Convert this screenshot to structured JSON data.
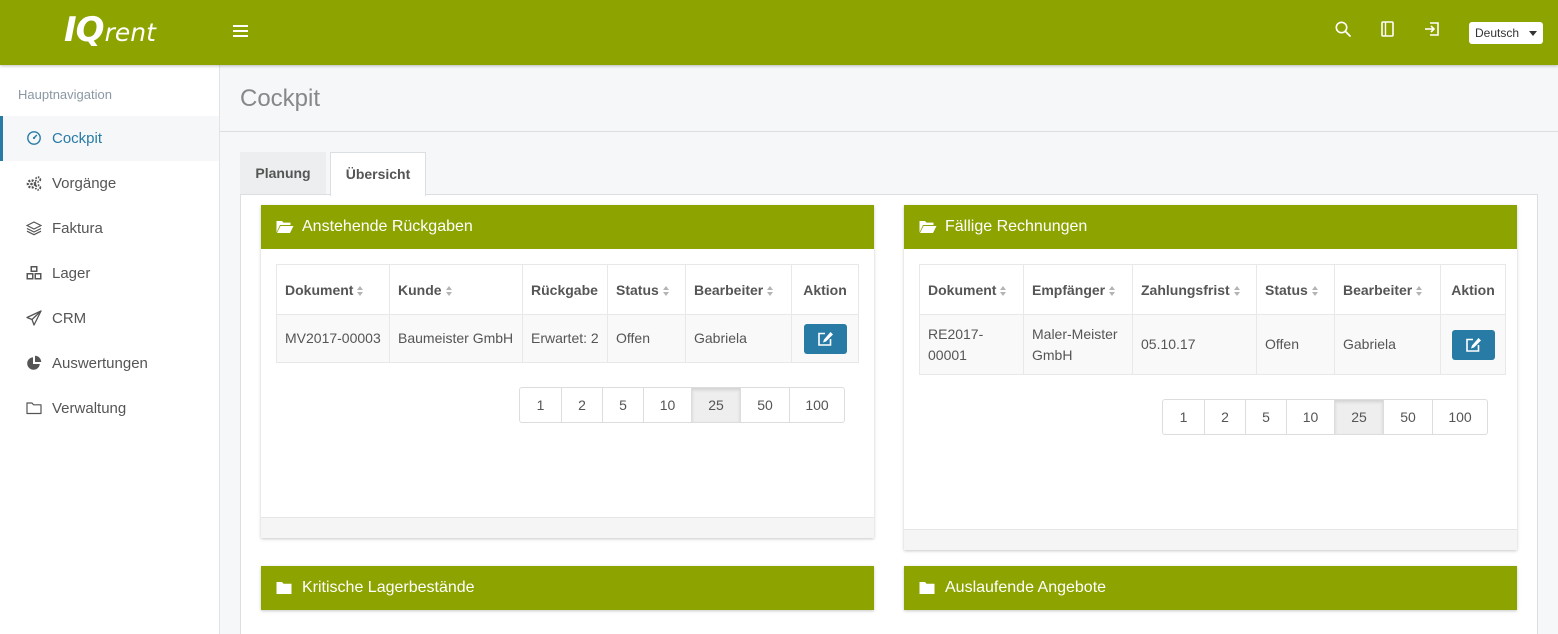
{
  "header": {
    "logo_iq": "IQ",
    "logo_rent": "rent",
    "language": "Deutsch"
  },
  "sidebar": {
    "heading": "Hauptnavigation",
    "items": [
      {
        "label": "Cockpit",
        "icon": "dashboard-icon",
        "active": true
      },
      {
        "label": "Vorgänge",
        "icon": "cogs-icon"
      },
      {
        "label": "Faktura",
        "icon": "layers-icon"
      },
      {
        "label": "Lager",
        "icon": "cubes-icon"
      },
      {
        "label": "CRM",
        "icon": "paper-plane-icon"
      },
      {
        "label": "Auswertungen",
        "icon": "pie-chart-icon"
      },
      {
        "label": "Verwaltung",
        "icon": "folder-icon"
      }
    ]
  },
  "page": {
    "title": "Cockpit",
    "tabs": [
      {
        "label": "Planung"
      },
      {
        "label": "Übersicht",
        "active": true
      }
    ]
  },
  "returns_panel": {
    "title": "Anstehende Rückgaben",
    "columns": [
      "Dokument",
      "Kunde",
      "Rückgabe",
      "Status",
      "Bearbeiter",
      "Aktion"
    ],
    "rows": [
      {
        "dokument": "MV2017-00003",
        "kunde": "Baumeister GmbH",
        "rueckgabe": "Erwartet: 2",
        "status": "Offen",
        "bearbeiter": "Gabriela"
      }
    ],
    "page_sizes": [
      "1",
      "2",
      "5",
      "10",
      "25",
      "50",
      "100"
    ],
    "active_page_size": "25"
  },
  "invoices_panel": {
    "title": "Fällige Rechnungen",
    "columns": [
      "Dokument",
      "Empfänger",
      "Zahlungsfrist",
      "Status",
      "Bearbeiter",
      "Aktion"
    ],
    "rows": [
      {
        "dokument_line1": "RE2017-",
        "dokument_line2": "00001",
        "empfaenger_line1": "Maler-Meister",
        "empfaenger_line2": "GmbH",
        "zahlungsfrist": "05.10.17",
        "status": "Offen",
        "bearbeiter": "Gabriela"
      }
    ],
    "page_sizes": [
      "1",
      "2",
      "5",
      "10",
      "25",
      "50",
      "100"
    ],
    "active_page_size": "25"
  },
  "stock_panel": {
    "title": "Kritische Lagerbestände"
  },
  "offers_panel": {
    "title": "Auslaufende Angebote"
  },
  "colors": {
    "brand_green": "#8ca300",
    "accent_blue": "#287ba5"
  }
}
